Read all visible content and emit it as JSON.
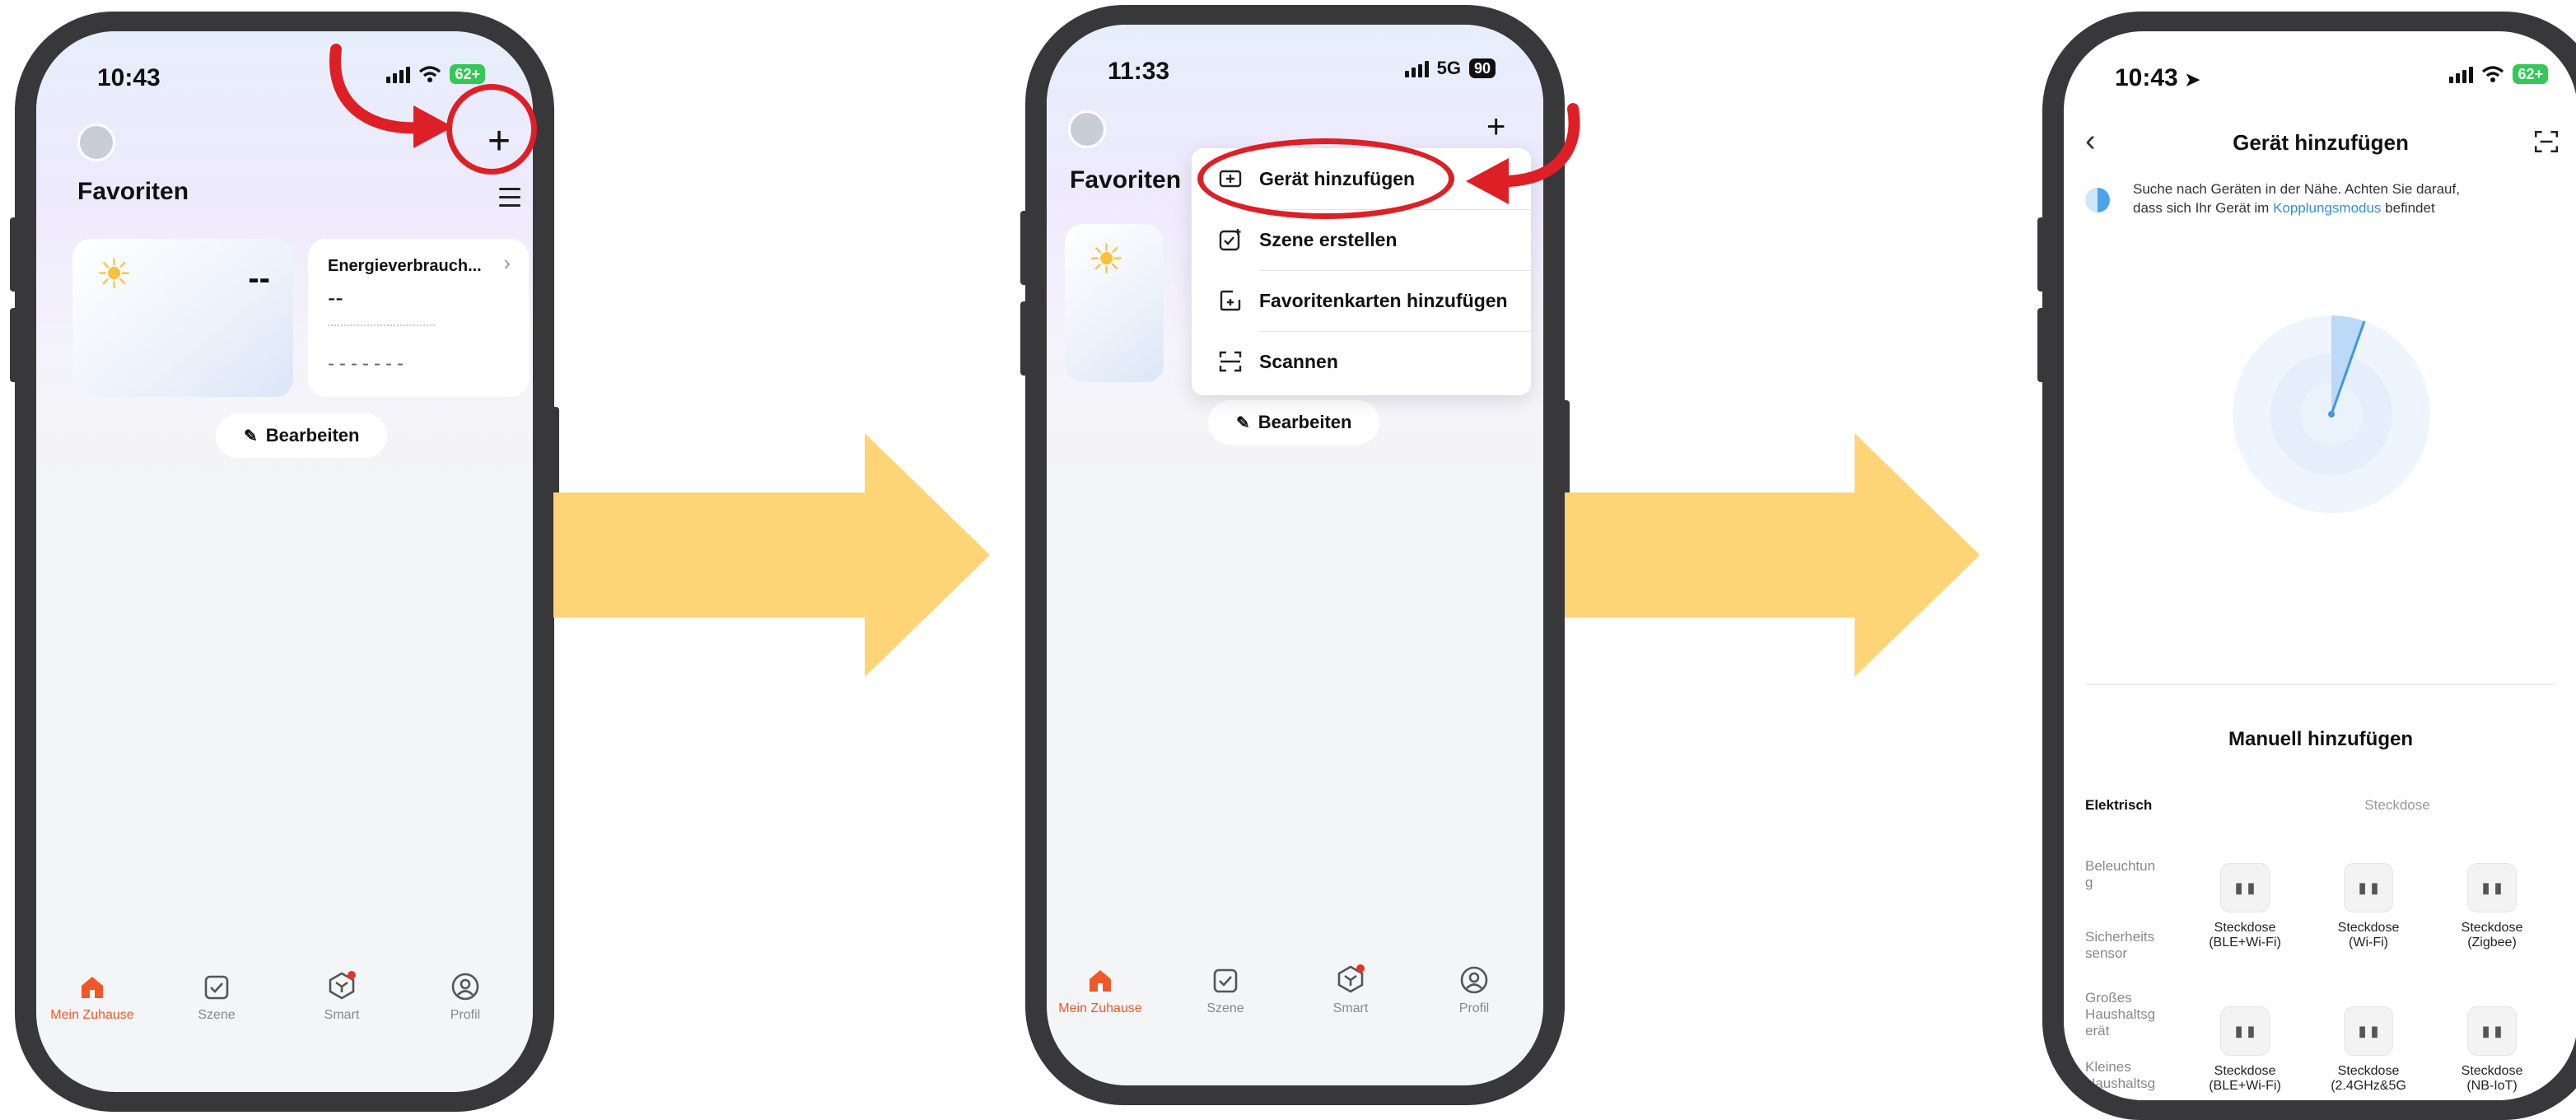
{
  "screen1": {
    "time": "10:43",
    "battery": "62+",
    "title": "Favoriten",
    "weather_value": "--",
    "energy_card": {
      "title": "Energieverbrauch...",
      "value": "--",
      "dashes": "-------"
    },
    "edit_label": "Bearbeiten",
    "tabs": [
      "Mein Zuhause",
      "Szene",
      "Smart",
      "Profil"
    ]
  },
  "screen2": {
    "time": "11:33",
    "network": "5G",
    "battery": "90",
    "title": "Favoriten",
    "menu": [
      "Gerät hinzufügen",
      "Szene erstellen",
      "Favoritenkarten hinzufügen",
      "Scannen"
    ],
    "edit_label": "Bearbeiten",
    "tabs": [
      "Mein Zuhause",
      "Szene",
      "Smart",
      "Profil"
    ]
  },
  "screen3": {
    "time": "10:43",
    "battery": "62+",
    "title": "Gerät hinzufügen",
    "hint_pre": "Suche nach Geräten in der Nähe. Achten Sie darauf,",
    "hint_line2_pre": "dass sich Ihr Gerät im",
    "hint_link": "Kopplungsmodus",
    "hint_post": "befindet",
    "manual_title": "Manuell hinzufügen",
    "categories": [
      "Elektrisch",
      "Beleuchtung",
      "Sicherheitssensor",
      "Großes Haushaltsgerät",
      "Kleines Haushaltsgerät"
    ],
    "category_display": [
      "Elektrisch",
      "Beleuchtun\ng",
      "Sicherheits\nsensor",
      "Großes\nHaushaltsg\nerät",
      "Kleines\nHaushaltsg\nerät"
    ],
    "section_label": "Steckdose",
    "devices": [
      {
        "name": "Steckdose",
        "sub": "(BLE+Wi-Fi)"
      },
      {
        "name": "Steckdose",
        "sub": "(Wi-Fi)"
      },
      {
        "name": "Steckdose",
        "sub": "(Zigbee)"
      },
      {
        "name": "Steckdose",
        "sub": "(BLE+Wi-Fi)"
      },
      {
        "name": "Steckdose",
        "sub": "(2.4GHz&5G"
      },
      {
        "name": "Steckdose",
        "sub": "(NB-IoT)"
      }
    ]
  },
  "colors": {
    "accent": "#f0582a",
    "annotation_red": "#dd1f26",
    "arrow_yellow": "#fdd476",
    "link_blue": "#2f8fe6",
    "battery_green": "#35c759"
  }
}
